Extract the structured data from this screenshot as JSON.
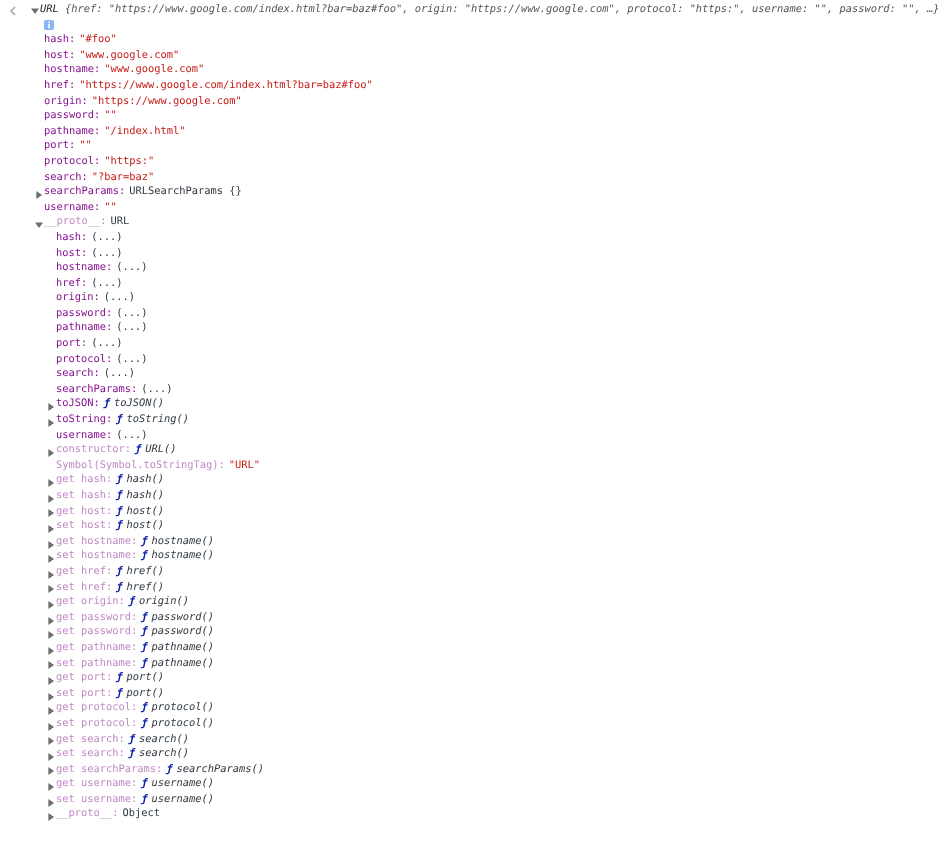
{
  "console_entry": {
    "expanded": true,
    "type_name": "URL",
    "summary": "{href: \"https://www.google.com/index.html?bar=baz#foo\", origin: \"https://www.google.com\", protocol: \"https:\", username: \"\", password: \"\", …}",
    "properties": [
      {
        "key": "hash:",
        "value": "\"#foo\"",
        "kind": "string",
        "dim": false
      },
      {
        "key": "host:",
        "value": "\"www.google.com\"",
        "kind": "string",
        "dim": false
      },
      {
        "key": "hostname:",
        "value": "\"www.google.com\"",
        "kind": "string",
        "dim": false
      },
      {
        "key": "href:",
        "value": "\"https://www.google.com/index.html?bar=baz#foo\"",
        "kind": "string",
        "dim": false
      },
      {
        "key": "origin:",
        "value": "\"https://www.google.com\"",
        "kind": "string",
        "dim": false
      },
      {
        "key": "password:",
        "value": "\"\"",
        "kind": "string",
        "dim": false
      },
      {
        "key": "pathname:",
        "value": "\"/index.html\"",
        "kind": "string",
        "dim": false
      },
      {
        "key": "port:",
        "value": "\"\"",
        "kind": "string",
        "dim": false
      },
      {
        "key": "protocol:",
        "value": "\"https:\"",
        "kind": "string",
        "dim": false
      },
      {
        "key": "search:",
        "value": "\"?bar=baz\"",
        "kind": "string",
        "dim": false
      },
      {
        "key": "searchParams:",
        "value": "URLSearchParams {}",
        "kind": "plain",
        "dim": false,
        "expanded": false
      },
      {
        "key": "username:",
        "value": "\"\"",
        "kind": "string",
        "dim": false
      },
      {
        "key": "__proto__:",
        "value": "URL",
        "kind": "plain",
        "dim": true,
        "expanded": true,
        "children": [
          {
            "key": "hash:",
            "value": "(...)",
            "kind": "plain",
            "dim": false
          },
          {
            "key": "host:",
            "value": "(...)",
            "kind": "plain",
            "dim": false
          },
          {
            "key": "hostname:",
            "value": "(...)",
            "kind": "plain",
            "dim": false
          },
          {
            "key": "href:",
            "value": "(...)",
            "kind": "plain",
            "dim": false
          },
          {
            "key": "origin:",
            "value": "(...)",
            "kind": "plain",
            "dim": false
          },
          {
            "key": "password:",
            "value": "(...)",
            "kind": "plain",
            "dim": false
          },
          {
            "key": "pathname:",
            "value": "(...)",
            "kind": "plain",
            "dim": false
          },
          {
            "key": "port:",
            "value": "(...)",
            "kind": "plain",
            "dim": false
          },
          {
            "key": "protocol:",
            "value": "(...)",
            "kind": "plain",
            "dim": false
          },
          {
            "key": "search:",
            "value": "(...)",
            "kind": "plain",
            "dim": false
          },
          {
            "key": "searchParams:",
            "value": "(...)",
            "kind": "plain",
            "dim": false
          },
          {
            "key": "toJSON:",
            "prefix": "ƒ",
            "value": "toJSON()",
            "kind": "function",
            "dim": false,
            "expanded": false
          },
          {
            "key": "toString:",
            "prefix": "ƒ",
            "value": "toString()",
            "kind": "function",
            "dim": false,
            "expanded": false
          },
          {
            "key": "username:",
            "value": "(...)",
            "kind": "plain",
            "dim": false
          },
          {
            "key": "constructor:",
            "prefix": "ƒ",
            "value": "URL()",
            "kind": "function",
            "dim": true,
            "expanded": false
          },
          {
            "key": "Symbol(Symbol.toStringTag):",
            "value": "\"URL\"",
            "kind": "string",
            "dim": true
          },
          {
            "key": "get hash:",
            "prefix": "ƒ",
            "value": "hash()",
            "kind": "function",
            "dim": true,
            "expanded": false
          },
          {
            "key": "set hash:",
            "prefix": "ƒ",
            "value": "hash()",
            "kind": "function",
            "dim": true,
            "expanded": false
          },
          {
            "key": "get host:",
            "prefix": "ƒ",
            "value": "host()",
            "kind": "function",
            "dim": true,
            "expanded": false
          },
          {
            "key": "set host:",
            "prefix": "ƒ",
            "value": "host()",
            "kind": "function",
            "dim": true,
            "expanded": false
          },
          {
            "key": "get hostname:",
            "prefix": "ƒ",
            "value": "hostname()",
            "kind": "function",
            "dim": true,
            "expanded": false
          },
          {
            "key": "set hostname:",
            "prefix": "ƒ",
            "value": "hostname()",
            "kind": "function",
            "dim": true,
            "expanded": false
          },
          {
            "key": "get href:",
            "prefix": "ƒ",
            "value": "href()",
            "kind": "function",
            "dim": true,
            "expanded": false
          },
          {
            "key": "set href:",
            "prefix": "ƒ",
            "value": "href()",
            "kind": "function",
            "dim": true,
            "expanded": false
          },
          {
            "key": "get origin:",
            "prefix": "ƒ",
            "value": "origin()",
            "kind": "function",
            "dim": true,
            "expanded": false
          },
          {
            "key": "get password:",
            "prefix": "ƒ",
            "value": "password()",
            "kind": "function",
            "dim": true,
            "expanded": false
          },
          {
            "key": "set password:",
            "prefix": "ƒ",
            "value": "password()",
            "kind": "function",
            "dim": true,
            "expanded": false
          },
          {
            "key": "get pathname:",
            "prefix": "ƒ",
            "value": "pathname()",
            "kind": "function",
            "dim": true,
            "expanded": false
          },
          {
            "key": "set pathname:",
            "prefix": "ƒ",
            "value": "pathname()",
            "kind": "function",
            "dim": true,
            "expanded": false
          },
          {
            "key": "get port:",
            "prefix": "ƒ",
            "value": "port()",
            "kind": "function",
            "dim": true,
            "expanded": false
          },
          {
            "key": "set port:",
            "prefix": "ƒ",
            "value": "port()",
            "kind": "function",
            "dim": true,
            "expanded": false
          },
          {
            "key": "get protocol:",
            "prefix": "ƒ",
            "value": "protocol()",
            "kind": "function",
            "dim": true,
            "expanded": false
          },
          {
            "key": "set protocol:",
            "prefix": "ƒ",
            "value": "protocol()",
            "kind": "function",
            "dim": true,
            "expanded": false
          },
          {
            "key": "get search:",
            "prefix": "ƒ",
            "value": "search()",
            "kind": "function",
            "dim": true,
            "expanded": false
          },
          {
            "key": "set search:",
            "prefix": "ƒ",
            "value": "search()",
            "kind": "function",
            "dim": true,
            "expanded": false
          },
          {
            "key": "get searchParams:",
            "prefix": "ƒ",
            "value": "searchParams()",
            "kind": "function",
            "dim": true,
            "expanded": false
          },
          {
            "key": "get username:",
            "prefix": "ƒ",
            "value": "username()",
            "kind": "function",
            "dim": true,
            "expanded": false
          },
          {
            "key": "set username:",
            "prefix": "ƒ",
            "value": "username()",
            "kind": "function",
            "dim": true,
            "expanded": false
          },
          {
            "key": "__proto__:",
            "value": "Object",
            "kind": "plain",
            "dim": true,
            "expanded": false
          }
        ]
      }
    ]
  }
}
